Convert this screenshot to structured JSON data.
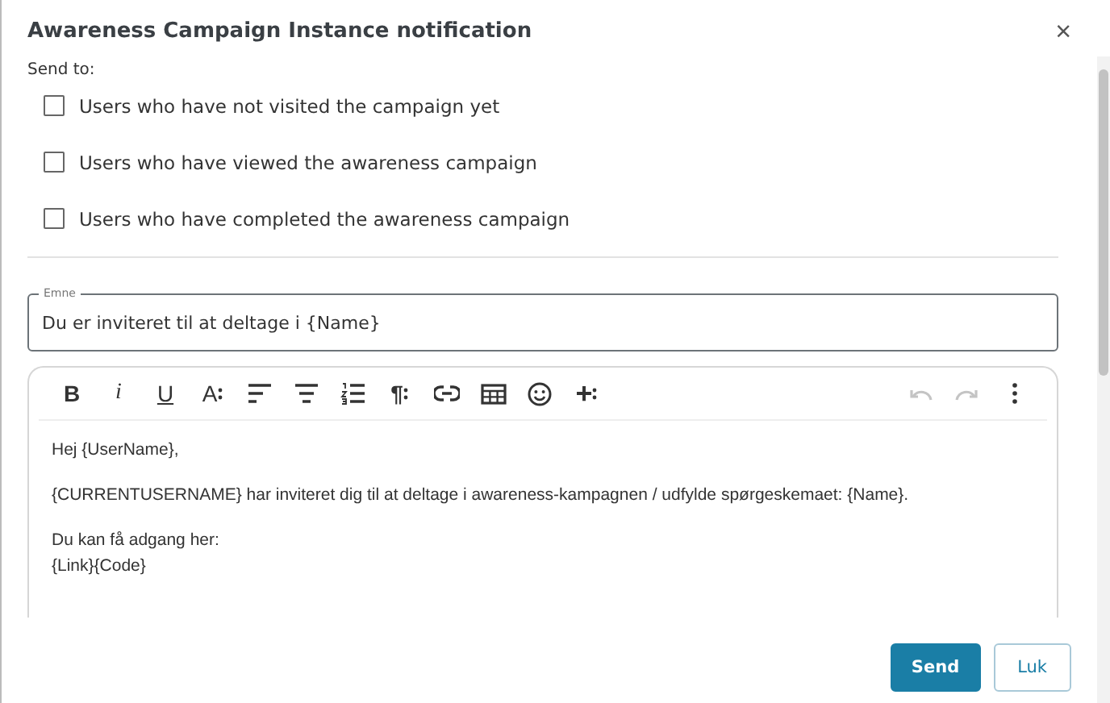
{
  "dialog": {
    "title": "Awareness Campaign Instance notification",
    "close": "×"
  },
  "send_to": {
    "label": "Send to:",
    "options": [
      {
        "label": "Users who have not visited the campaign yet",
        "checked": false
      },
      {
        "label": "Users who have viewed the awareness campaign",
        "checked": false
      },
      {
        "label": "Users who have completed the awareness campaign",
        "checked": false
      }
    ]
  },
  "subject": {
    "label": "Emne",
    "value": "Du er inviteret til at deltage i {Name}"
  },
  "toolbar": [
    {
      "kind": "bold",
      "glyph": "B"
    },
    {
      "kind": "italic",
      "glyph": "i"
    },
    {
      "kind": "underline",
      "glyph": "U"
    },
    {
      "kind": "font-size",
      "glyph": "A"
    },
    {
      "kind": "align-left"
    },
    {
      "kind": "align-center"
    },
    {
      "kind": "ordered-list"
    },
    {
      "kind": "paragraph",
      "glyph": "¶"
    },
    {
      "kind": "link"
    },
    {
      "kind": "table"
    },
    {
      "kind": "emoji"
    },
    {
      "kind": "insert",
      "glyph": "+"
    }
  ],
  "toolbar_right": [
    {
      "kind": "undo",
      "disabled": true
    },
    {
      "kind": "redo",
      "disabled": true
    },
    {
      "kind": "more",
      "disabled": false
    }
  ],
  "body": [
    [
      "Hej {UserName},"
    ],
    [
      "{CURRENTUSERNAME} har inviteret dig til at deltage i awareness-kampagnen / udfylde spørgeskemaet: {Name}."
    ],
    [
      "Du kan få adgang her:",
      "{Link}{Code}"
    ]
  ],
  "buttons": [
    {
      "label": "Send",
      "kind": "primary"
    },
    {
      "label": "Luk",
      "kind": "secondary"
    }
  ]
}
